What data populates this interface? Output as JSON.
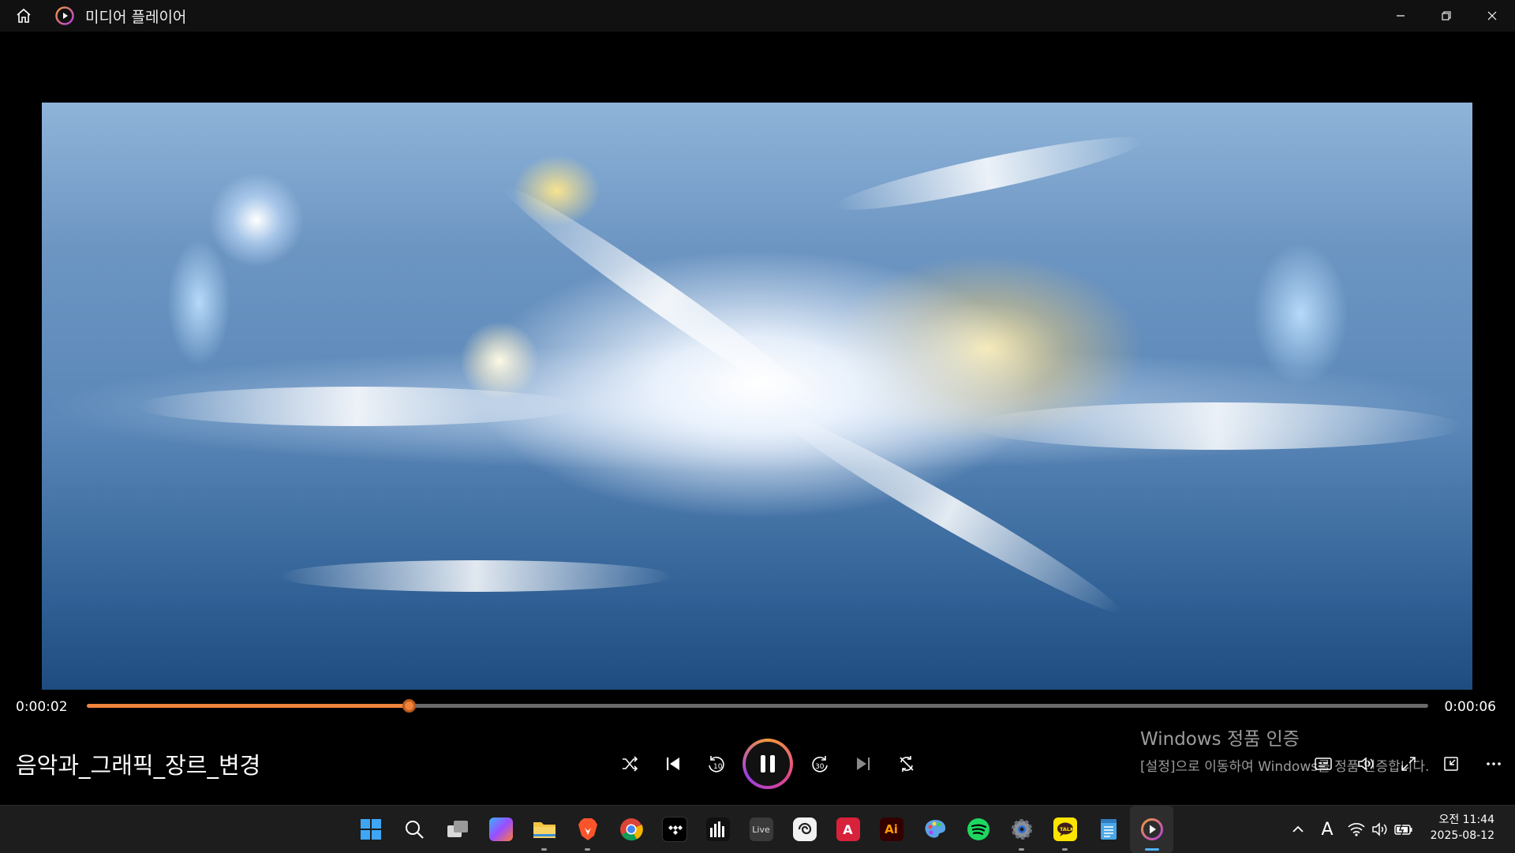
{
  "titlebar": {
    "app_title": "미디어 플레이어"
  },
  "player": {
    "elapsed": "0:00:02",
    "total": "0:00:06",
    "progress_fraction": 0.24,
    "track_title": "음악과_그래픽_장르_변경",
    "accent_color": "#f0843c"
  },
  "watermark": {
    "title": "Windows 정품 인증",
    "subtitle": "[설정]으로 이동하여 Windows를 정품 인증합니다."
  },
  "taskbar": {
    "apps": [
      "windows-start",
      "search",
      "task-view",
      "copilot",
      "file-explorer",
      "brave",
      "chrome",
      "tidal",
      "audio-visualizer",
      "live",
      "clip-studio",
      "autocad",
      "illustrator",
      "paint",
      "spotify",
      "settings",
      "kakaotalk",
      "notepad",
      "media-player"
    ],
    "tray_input_indicator": "A",
    "clock_time": "오전 11:44",
    "clock_date": "2025-08-12"
  }
}
